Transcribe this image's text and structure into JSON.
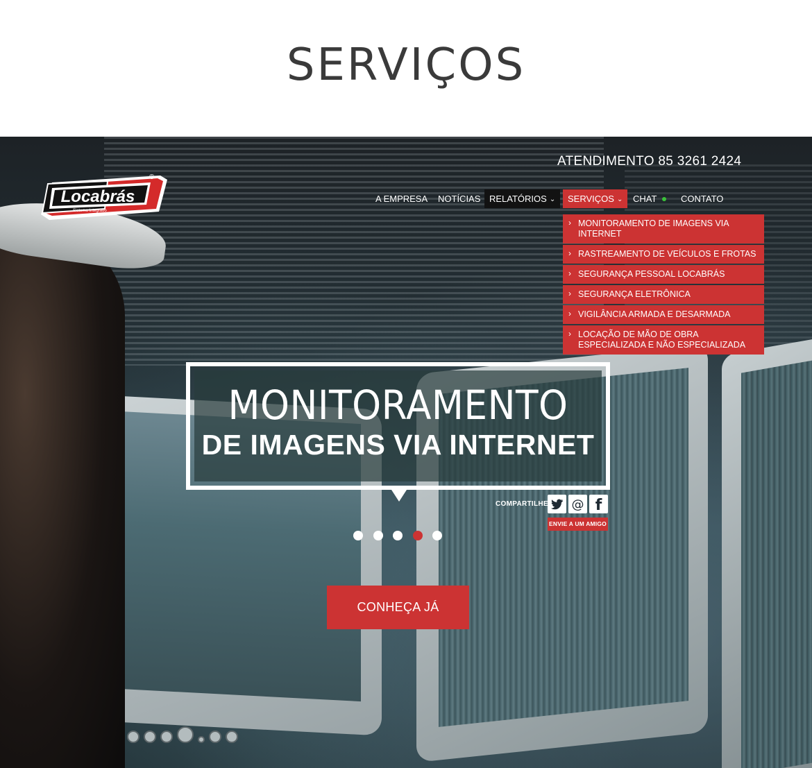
{
  "page_title": "SERVIÇOS",
  "header": {
    "atendimento": "ATENDIMENTO 85 3261 2424",
    "logo_text": "Locabrás",
    "logo_tagline": "Sistema Integrado",
    "logo_mark": "®"
  },
  "nav": {
    "items": [
      {
        "label": "A EMPRESA"
      },
      {
        "label": "NOTÍCIAS"
      },
      {
        "label": "RELATÓRIOS"
      },
      {
        "label": "SERVIÇOS"
      },
      {
        "label": "CHAT"
      },
      {
        "label": "CONTATO"
      }
    ],
    "chevron": "⌄",
    "active": "SERVIÇOS"
  },
  "dropdown": {
    "arrow": "›",
    "items": [
      {
        "label": "MONITORAMENTO DE IMAGENS VIA INTERNET"
      },
      {
        "label": "RASTREAMENTO DE VEÍCULOS E FROTAS"
      },
      {
        "label": "SEGURANÇA PESSOAL LOCABRÁS"
      },
      {
        "label": "SEGURANÇA ELETRÔNICA"
      },
      {
        "label": "VIGILÂNCIA ARMADA E DESARMADA"
      },
      {
        "label": "LOCAÇÃO DE MÃO DE OBRA ESPECIALIZADA E NÃO ESPECIALIZADA"
      }
    ]
  },
  "banner": {
    "line1": "MONITORAMENTO",
    "line2": "DE IMAGENS VIA INTERNET"
  },
  "share": {
    "label": "COMPARTILHE",
    "icons": [
      "twitter-icon",
      "email-icon",
      "facebook-icon"
    ],
    "at_glyph": "@",
    "f_glyph": "f",
    "send_friend": "ENVIE A UM AMIGO"
  },
  "carousel": {
    "total": 5,
    "active_index": 3
  },
  "cta_label": "CONHEÇA JÁ",
  "colors": {
    "accent": "#cc3333",
    "online": "#3ac23a",
    "nav_dark": "#121212"
  }
}
